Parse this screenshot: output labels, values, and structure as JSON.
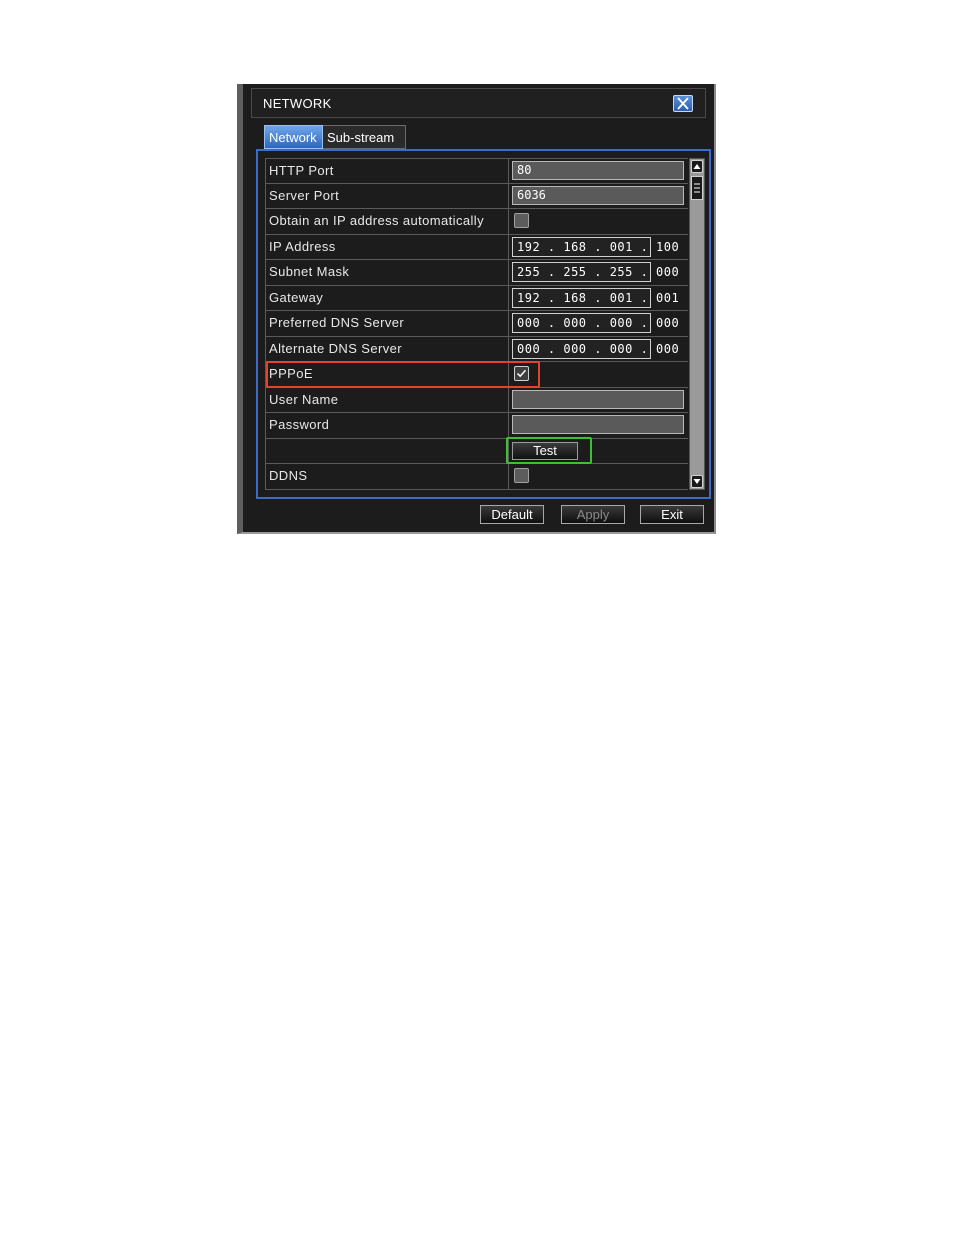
{
  "window": {
    "title": "NETWORK"
  },
  "tabs": [
    {
      "label": "Network",
      "active": true
    },
    {
      "label": "Sub-stream",
      "active": false
    }
  ],
  "rows": {
    "http_port": {
      "label": "HTTP Port",
      "value": "80"
    },
    "server_port": {
      "label": "Server Port",
      "value": "6036"
    },
    "obtain_ip": {
      "label": "Obtain an IP address automatically",
      "checked": false
    },
    "ip_address": {
      "label": "IP Address",
      "value": "192 . 168 . 001 . 100"
    },
    "subnet_mask": {
      "label": "Subnet Mask",
      "value": "255 . 255 . 255 . 000"
    },
    "gateway": {
      "label": "Gateway",
      "value": "192 . 168 . 001 . 001"
    },
    "preferred_dns": {
      "label": "Preferred DNS Server",
      "value": "000 . 000 . 000 . 000"
    },
    "alternate_dns": {
      "label": "Alternate DNS Server",
      "value": "000 . 000 . 000 . 000"
    },
    "pppoe": {
      "label": "PPPoE",
      "checked": true
    },
    "user_name": {
      "label": "User Name",
      "value": ""
    },
    "password": {
      "label": "Password",
      "value": ""
    },
    "test": {
      "button_label": "Test"
    },
    "ddns": {
      "label": "DDNS",
      "checked": false
    }
  },
  "footer": {
    "default_label": "Default",
    "apply_label": "Apply",
    "exit_label": "Exit"
  },
  "colors": {
    "accent_blue": "#3a6cc8",
    "highlight_red": "#e0452e",
    "highlight_green": "#3fbf34"
  }
}
